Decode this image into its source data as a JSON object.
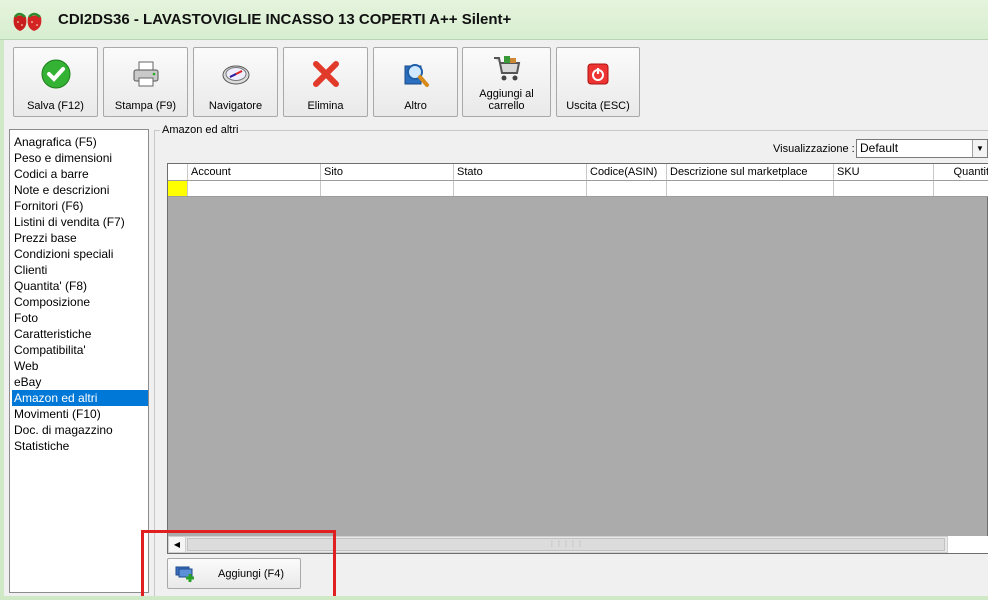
{
  "window": {
    "title": "CDI2DS36 - LAVASTOVIGLIE INCASSO 13 COPERTI A++ Silent+"
  },
  "toolbar": {
    "buttons": [
      {
        "label": "Salva (F12)",
        "icon": "checkmark-icon"
      },
      {
        "label": "Stampa (F9)",
        "icon": "printer-icon"
      },
      {
        "label": "Navigatore",
        "icon": "compass-icon"
      },
      {
        "label": "Elimina",
        "icon": "delete-x-icon"
      },
      {
        "label": "Altro",
        "icon": "magnifier-icon"
      },
      {
        "label": "Aggiungi al carrello",
        "icon": "cart-icon"
      },
      {
        "label": "Uscita (ESC)",
        "icon": "power-icon"
      }
    ]
  },
  "sidebar": {
    "items": [
      {
        "label": "Anagrafica (F5)"
      },
      {
        "label": "Peso e dimensioni"
      },
      {
        "label": "Codici a barre"
      },
      {
        "label": "Note e descrizioni"
      },
      {
        "label": "Fornitori (F6)"
      },
      {
        "label": "Listini di vendita (F7)"
      },
      {
        "label": "Prezzi base"
      },
      {
        "label": "Condizioni speciali"
      },
      {
        "label": "Clienti"
      },
      {
        "label": "Quantita' (F8)"
      },
      {
        "label": "Composizione"
      },
      {
        "label": "Foto"
      },
      {
        "label": "Caratteristiche"
      },
      {
        "label": "Compatibilita'"
      },
      {
        "label": "Web"
      },
      {
        "label": "eBay"
      },
      {
        "label": "Amazon ed altri",
        "selected": true
      },
      {
        "label": "Movimenti (F10)"
      },
      {
        "label": "Doc. di magazzino"
      },
      {
        "label": "Statistiche"
      }
    ]
  },
  "main": {
    "group_title": "Amazon ed altri",
    "view_label": "Visualizzazione :",
    "view_value": "Default",
    "grid": {
      "columns": [
        "Account",
        "Sito",
        "Stato",
        "Codice(ASIN)",
        "Descrizione sul marketplace",
        "SKU",
        "Quantit"
      ],
      "rows": [
        [
          "",
          "",
          "",
          "",
          "",
          "",
          ""
        ]
      ]
    },
    "add_button": {
      "label": "Aggiungi (F4)",
      "icon": "add-item-icon"
    }
  },
  "colors": {
    "selection": "#0078d7",
    "row_indicator": "#ffff00",
    "title_bg": "#d7eed0",
    "highlight": "#e02020"
  }
}
